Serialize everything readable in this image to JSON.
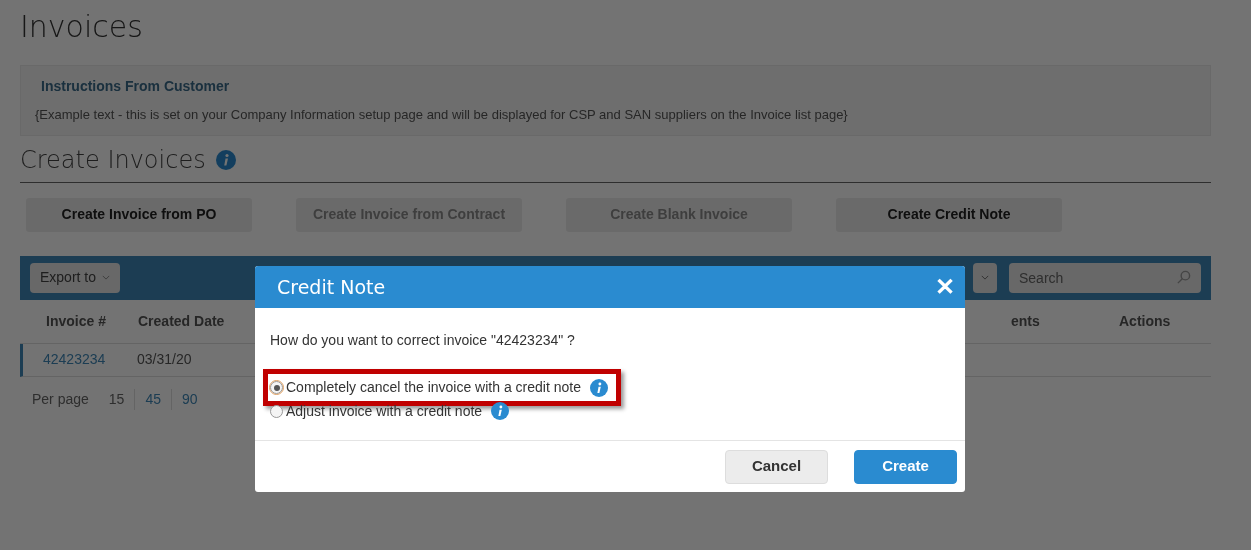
{
  "page_title": "Invoices",
  "instructions": {
    "title": "Instructions From Customer",
    "text": "{Example text - this is set on your Company Information setup page and will be displayed for CSP and SAN suppliers on the Invoice list page}"
  },
  "section_title": "Create Invoices",
  "create_buttons": [
    {
      "label": "Create Invoice from PO",
      "disabled": false
    },
    {
      "label": "Create Invoice from Contract",
      "disabled": true
    },
    {
      "label": "Create Blank Invoice",
      "disabled": true
    },
    {
      "label": "Create Credit Note",
      "disabled": false
    }
  ],
  "toolbar": {
    "export_label": "Export to",
    "search_placeholder": "Search"
  },
  "table": {
    "columns": [
      "Invoice #",
      "Created Date",
      "ents",
      "Actions"
    ],
    "rows": [
      {
        "invoice": "42423234",
        "created_date": "03/31/20"
      }
    ]
  },
  "pagination": {
    "label": "Per page",
    "options": [
      {
        "label": "15",
        "selected": true
      },
      {
        "label": "45",
        "selected": false
      },
      {
        "label": "90",
        "selected": false
      }
    ]
  },
  "dialog": {
    "title": "Credit Note",
    "close": "✕",
    "question": "How do you want to correct invoice \"42423234\" ?",
    "options": [
      {
        "label": "Completely cancel the invoice with a credit note",
        "selected": true,
        "highlighted": true
      },
      {
        "label": "Adjust invoice with a credit note",
        "selected": false,
        "highlighted": false
      }
    ],
    "buttons": [
      {
        "label": "Cancel",
        "kind": "secondary"
      },
      {
        "label": "Create",
        "kind": "primary"
      }
    ]
  }
}
